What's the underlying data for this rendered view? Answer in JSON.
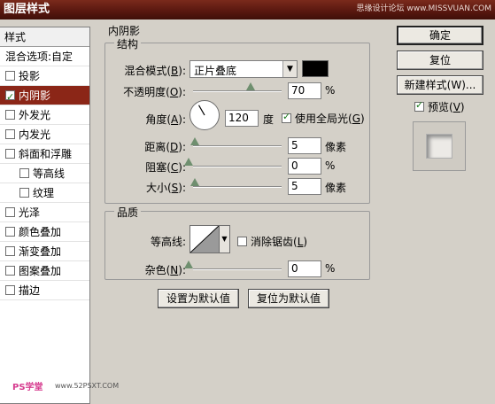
{
  "window": {
    "title": "图层样式",
    "watermark": "思缘设计论坛  www.MISSVUAN.COM"
  },
  "left_panel": {
    "header": "样式",
    "blend_options": "混合选项:自定",
    "items": [
      {
        "label": "投影",
        "checked": false,
        "active": false,
        "sub": false
      },
      {
        "label": "内阴影",
        "checked": true,
        "active": true,
        "sub": false
      },
      {
        "label": "外发光",
        "checked": false,
        "active": false,
        "sub": false
      },
      {
        "label": "内发光",
        "checked": false,
        "active": false,
        "sub": false
      },
      {
        "label": "斜面和浮雕",
        "checked": false,
        "active": false,
        "sub": false
      },
      {
        "label": "等高线",
        "checked": false,
        "active": false,
        "sub": true
      },
      {
        "label": "纹理",
        "checked": false,
        "active": false,
        "sub": true
      },
      {
        "label": "光泽",
        "checked": false,
        "active": false,
        "sub": false
      },
      {
        "label": "颜色叠加",
        "checked": false,
        "active": false,
        "sub": false
      },
      {
        "label": "渐变叠加",
        "checked": false,
        "active": false,
        "sub": false
      },
      {
        "label": "图案叠加",
        "checked": false,
        "active": false,
        "sub": false
      },
      {
        "label": "描边",
        "checked": false,
        "active": false,
        "sub": false
      }
    ]
  },
  "inner_shadow": {
    "title": "内阴影",
    "structure": {
      "title": "结构",
      "blend_mode": {
        "label": "混合模式(",
        "key": "B",
        "suffix": "):",
        "value": "正片叠底"
      },
      "color": "#000000",
      "opacity": {
        "label": "不透明度(",
        "key": "O",
        "suffix": "):",
        "value": "70",
        "unit": "%",
        "level": 70
      },
      "angle": {
        "label": "角度(",
        "key": "A",
        "suffix": "):",
        "value": "120",
        "unit": "度",
        "degrees": 120
      },
      "global_light": {
        "label": "使用全局光(",
        "key": "G",
        "suffix": ")",
        "checked": true
      },
      "distance": {
        "label": "距离(",
        "key": "D",
        "suffix": "):",
        "value": "5",
        "unit": "像素",
        "level": 5
      },
      "choke": {
        "label": "阻塞(",
        "key": "C",
        "suffix": "):",
        "value": "0",
        "unit": "%",
        "level": 0
      },
      "size": {
        "label": "大小(",
        "key": "S",
        "suffix": "):",
        "value": "5",
        "unit": "像素",
        "level": 5
      }
    },
    "quality": {
      "title": "品质",
      "contour_label": "等高线:",
      "anti_alias": {
        "label": "消除锯齿(",
        "key": "L",
        "suffix": ")",
        "checked": false
      },
      "noise": {
        "label": "杂色(",
        "key": "N",
        "suffix": "):",
        "value": "0",
        "unit": "%",
        "level": 0
      }
    },
    "buttons": {
      "make_default": "设置为默认值",
      "reset_default": "复位为默认值"
    }
  },
  "right_panel": {
    "ok": "确定",
    "reset": "复位",
    "new_style": "新建样式(W)...",
    "preview": {
      "label": "预览(",
      "key": "V",
      "suffix": ")",
      "checked": true
    }
  },
  "footer": {
    "logo": "PS学堂",
    "url": "www.52PSXT.COM"
  }
}
